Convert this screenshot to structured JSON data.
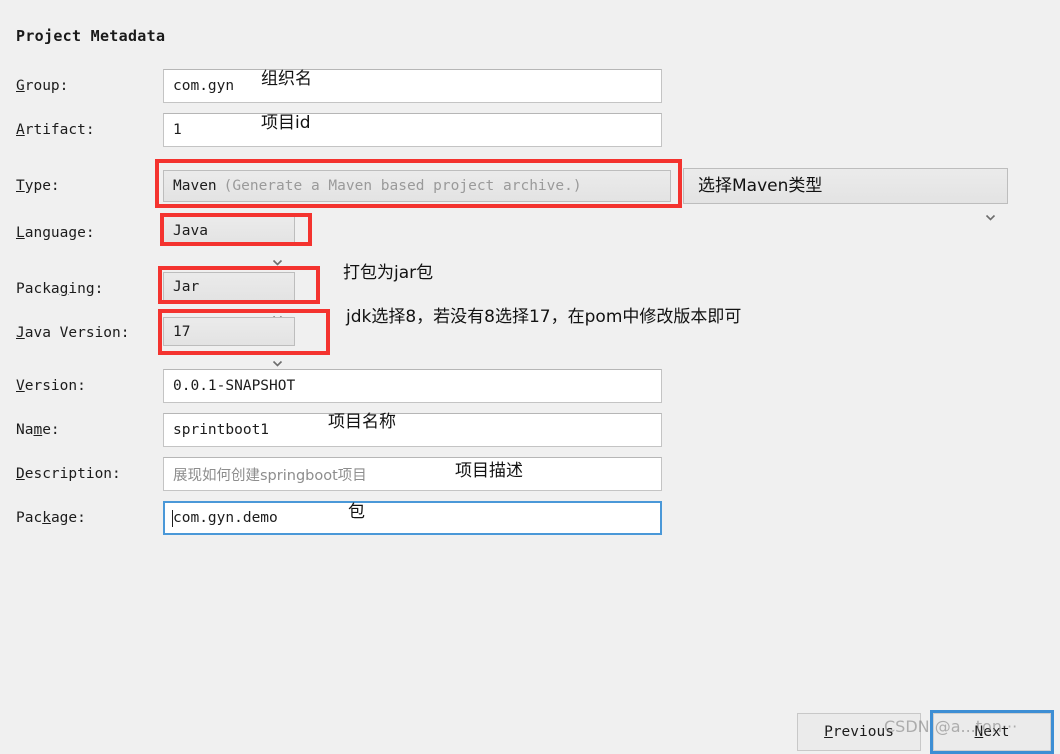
{
  "page_title": "Project Metadata",
  "colors": {
    "background": "#f0f0f0",
    "annotation_red": "#f4332f",
    "focus_blue": "#4a98d8",
    "input_white": "#ffffff",
    "combo_grey": "#e6e6e6",
    "muted_text": "#8d8d8d"
  },
  "fields": {
    "group": {
      "label_pre": "",
      "label_mnemonic": "G",
      "label_post": "roup:",
      "value": "com.gyn"
    },
    "artifact": {
      "label_pre": "",
      "label_mnemonic": "A",
      "label_post": "rtifact:",
      "value": "1"
    },
    "type": {
      "label_pre": "",
      "label_mnemonic": "T",
      "label_post": "ype:",
      "value": "Maven",
      "value_hint": "(Generate a Maven based project archive.)"
    },
    "language": {
      "label_pre": "",
      "label_mnemonic": "L",
      "label_post": "anguage:",
      "value": "Java"
    },
    "packaging": {
      "label_pre": "Packa",
      "label_mnemonic": "g",
      "label_post": "ing:",
      "value": "Jar"
    },
    "java_version": {
      "label_pre": "",
      "label_mnemonic": "J",
      "label_post": "ava Version:",
      "value": "17"
    },
    "version": {
      "label_pre": "",
      "label_mnemonic": "V",
      "label_post": "ersion:",
      "value": "0.0.1-SNAPSHOT"
    },
    "name": {
      "label_pre": "Na",
      "label_mnemonic": "m",
      "label_post": "e:",
      "value": "sprintboot1"
    },
    "description": {
      "label_pre": "",
      "label_mnemonic": "D",
      "label_post": "escription:",
      "value": "展现如何创建springboot项目"
    },
    "package": {
      "label_pre": "Pac",
      "label_mnemonic": "k",
      "label_post": "age:",
      "value": "com.gyn.demo"
    }
  },
  "annotations": {
    "group": "组织名",
    "artifact": "项目id",
    "type": "选择Maven类型",
    "packaging": "打包为jar包",
    "java_version": "jdk选择8，若没有8选择17，在pom中修改版本即可",
    "name": "项目名称",
    "description": "项目描述",
    "package": "包"
  },
  "footer": {
    "previous": {
      "pre": "",
      "mnemonic": "P",
      "post": "revious"
    },
    "next": {
      "pre": "",
      "mnemonic": "N",
      "post": "ext"
    }
  },
  "watermark": "CSDN @a...ton···"
}
